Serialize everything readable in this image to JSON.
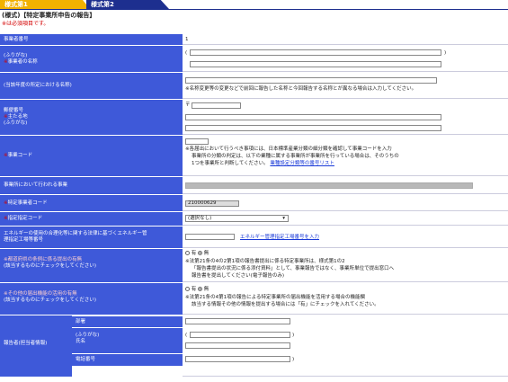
{
  "tabs": [
    "様式第1",
    "様式第2"
  ],
  "form_title": "(様式)【特定事業所申告の報告】",
  "required_note": "※は必須項目です。",
  "rows": {
    "business_number": {
      "label": "事業者番号",
      "value": "1"
    },
    "business_name": {
      "label_kana": "(ふりがな)",
      "label": "事業者の名称",
      "open_paren": "(",
      "close_paren": ")"
    },
    "former_name": {
      "label": "(当該年度の所定における名称)",
      "note": "※名称変更等の変更などで前回に報告した名称と今回報告する名称とが異なる場合は入力してください。"
    },
    "address": {
      "label_postal": "郵便番号",
      "label": "主たる地",
      "label_kana": "(ふりがな)",
      "postal_mark": "〒"
    },
    "business_code": {
      "label": "事業コード",
      "note_line1": "※各届出において行うべき事項には、日本標準産業分類の細分類を確認して事業コードを入力",
      "note_line2": "事業所の分類の判定は、以下の業種に属する事業所が事業所を行っている場合は、そのうちの",
      "note_line3": "1つを事業所と判断してください。",
      "note_link": "業種設定分類等の番号リスト"
    },
    "main_business": {
      "label": "事業所において行われる事業"
    },
    "specific_code": {
      "label": "特定事業者コード",
      "value": "210000629"
    },
    "designated_code": {
      "label": "指定指定コード",
      "select": "(選択なし)"
    },
    "energy": {
      "label_line1": "エネルギーの使用の合理化等に関する法律に基づくエネルギー管",
      "label_line2": "理指定工場等番号",
      "link": "エネルギー管理指定工場番号を入力"
    },
    "cooperation": {
      "label_line1": "※都道府県の条例に係る提出の有無",
      "label_line2": "(該当するものにチェックをしてください)",
      "opt_yes": "有",
      "opt_no": "無",
      "note_line1": "※法第21条の4の2第1項の報告書提出に係る特定事業所は、様式第1の2",
      "note_line2": "「報告書提出の状況に係る添付資料」として、事業報告ではなく、事業所単位で提出窓口へ",
      "note_line3": "報告書を提出してください(電子報告のみ)"
    },
    "other": {
      "label_line1": "※その他の届出機能の活用の有無",
      "label_line2": "(該当するものにチェックをしてください)",
      "opt_yes": "有",
      "opt_no": "無",
      "note_line1": "※法第21条の4第1項の報告による特定事業所の届出機能を活用する場合の機能欄",
      "note_line2": "該当する情報その他の情報を提出する場合には「有」にチェックを入れてください。"
    },
    "reporter": {
      "label": "報告者(担当者情報)",
      "dept_label": "部署",
      "name_kana": "(ふりがな)",
      "name_label": "氏名",
      "phone_label": "電話番号",
      "open_paren": "(",
      "close_paren": ")"
    }
  }
}
